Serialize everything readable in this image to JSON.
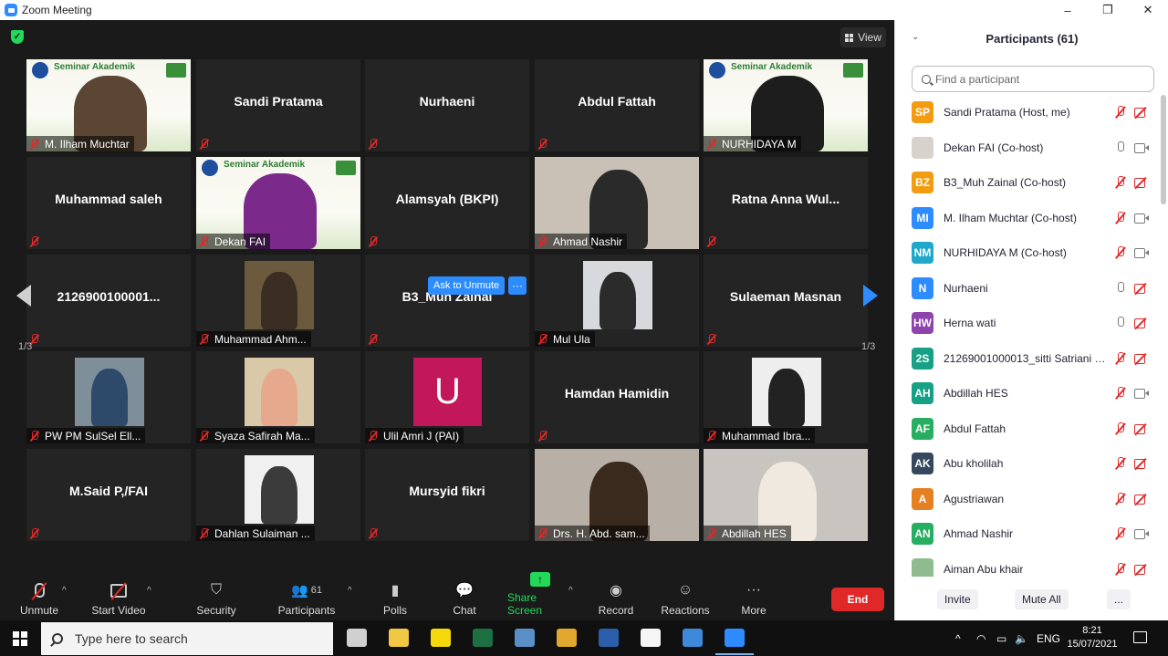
{
  "window": {
    "title": "Zoom Meeting",
    "controls": [
      "–",
      "❐",
      "✕"
    ]
  },
  "video": {
    "view_label": "View",
    "page_indicator": "1/3",
    "ask_unmute_label": "Ask to Unmute",
    "more_label": "···",
    "tiles": [
      {
        "name": "M. Ilham Muchtar",
        "display": "",
        "type": "seminar",
        "person_color": "#5a4632"
      },
      {
        "name": "",
        "display": "Sandi Pratama",
        "type": "name"
      },
      {
        "name": "",
        "display": "Nurhaeni",
        "type": "name"
      },
      {
        "name": "",
        "display": "Abdul Fattah",
        "type": "name"
      },
      {
        "name": "NURHIDAYA M",
        "display": "",
        "type": "seminar",
        "person_color": "#1d1d1d"
      },
      {
        "name": "",
        "display": "Muhammad saleh",
        "type": "name"
      },
      {
        "name": "Dekan FAI",
        "display": "",
        "type": "seminar",
        "person_color": "#7b2a8c"
      },
      {
        "name": "",
        "display": "Alamsyah (BKPI)",
        "type": "name"
      },
      {
        "name": "Ahmad Nashir",
        "display": "",
        "type": "photo",
        "bg": "#c9c0b6",
        "person_color": "#2a2a2a"
      },
      {
        "name": "",
        "display": "Ratna Anna Wul...",
        "type": "name"
      },
      {
        "name": "",
        "display": "2126900100001...",
        "type": "name"
      },
      {
        "name": "Muhammad Ahm...",
        "display": "",
        "type": "thumb",
        "bg": "#6b5a3e",
        "person_color": "#3a2e22"
      },
      {
        "name": "",
        "display": "B3_Muh Zainal",
        "type": "name"
      },
      {
        "name": "Mul Ula",
        "display": "",
        "type": "thumb",
        "bg": "#d7d9dc",
        "person_color": "#2b2b2b"
      },
      {
        "name": "",
        "display": "Sulaeman Masnan",
        "type": "name"
      },
      {
        "name": "PW PM SulSel Ell...",
        "display": "",
        "type": "thumb",
        "bg": "#7e8f9a",
        "person_color": "#2e4a6b"
      },
      {
        "name": "Syaza Safirah Ma...",
        "display": "",
        "type": "thumb",
        "bg": "#d9c9a8",
        "person_color": "#e7a98d"
      },
      {
        "name": "Ulil Amri J (PAI)",
        "display": "U",
        "type": "letter",
        "bg": "#c2185b"
      },
      {
        "name": "",
        "display": "Hamdan Hamidin",
        "type": "name"
      },
      {
        "name": "Muhammad Ibra...",
        "display": "",
        "type": "thumb",
        "bg": "#eeeeee",
        "person_color": "#222222"
      },
      {
        "name": "",
        "display": "M.Said P,/FAI",
        "type": "name"
      },
      {
        "name": "Dahlan Sulaiman ...",
        "display": "",
        "type": "thumb",
        "bg": "#f0f0f0",
        "person_color": "#3b3b3b"
      },
      {
        "name": "",
        "display": "Mursyid fikri",
        "type": "name"
      },
      {
        "name": "Drs. H. Abd. sam...",
        "display": "",
        "type": "photo",
        "bg": "#b8b0a6",
        "person_color": "#3a2a1e"
      },
      {
        "name": "Abdillah HES",
        "display": "",
        "type": "photo",
        "bg": "#c8c4bf",
        "person_color": "#efe9df"
      }
    ],
    "banner_title": "Seminar Akademik"
  },
  "toolbar": {
    "unmute": "Unmute",
    "start_video": "Start Video",
    "security": "Security",
    "participants": "Participants",
    "participants_count": "61",
    "polls": "Polls",
    "chat": "Chat",
    "share_screen": "Share Screen",
    "record": "Record",
    "reactions": "Reactions",
    "more": "More",
    "end": "End"
  },
  "participants_panel": {
    "title": "Participants (61)",
    "search_placeholder": "Find a participant",
    "invite": "Invite",
    "mute_all": "Mute All",
    "more": "...",
    "items": [
      {
        "initials": "SP",
        "color": "#f39c12",
        "name": "Sandi Pratama (Host, me)",
        "mic": "muted",
        "cam": "off"
      },
      {
        "initials": "",
        "color": "#d8d2cc",
        "name": "Dekan FAI (Co-host)",
        "mic": "on",
        "cam": "on"
      },
      {
        "initials": "BZ",
        "color": "#f39c12",
        "name": "B3_Muh Zainal (Co-host)",
        "mic": "muted",
        "cam": "off"
      },
      {
        "initials": "MI",
        "color": "#2d8cff",
        "name": "M. Ilham Muchtar (Co-host)",
        "mic": "muted",
        "cam": "on"
      },
      {
        "initials": "NM",
        "color": "#1fa8c9",
        "name": "NURHIDAYA M (Co-host)",
        "mic": "muted",
        "cam": "on"
      },
      {
        "initials": "N",
        "color": "#2d8cff",
        "name": "Nurhaeni",
        "mic": "on",
        "cam": "off"
      },
      {
        "initials": "HW",
        "color": "#8e44ad",
        "name": "Herna wati",
        "mic": "on",
        "cam": "off"
      },
      {
        "initials": "2S",
        "color": "#16a085",
        "name": "21269001000013_sitti Satriani Is...",
        "mic": "muted",
        "cam": "off"
      },
      {
        "initials": "AH",
        "color": "#16a085",
        "name": "Abdillah HES",
        "mic": "muted",
        "cam": "on"
      },
      {
        "initials": "AF",
        "color": "#27ae60",
        "name": "Abdul Fattah",
        "mic": "muted",
        "cam": "off"
      },
      {
        "initials": "AK",
        "color": "#34495e",
        "name": "Abu kholilah",
        "mic": "muted",
        "cam": "off"
      },
      {
        "initials": "A",
        "color": "#e67e22",
        "name": "Agustriawan",
        "mic": "muted",
        "cam": "off"
      },
      {
        "initials": "AN",
        "color": "#27ae60",
        "name": "Ahmad Nashir",
        "mic": "muted",
        "cam": "on"
      },
      {
        "initials": "",
        "color": "#8fbc8f",
        "name": "Aiman Abu khair",
        "mic": "muted",
        "cam": "off"
      }
    ]
  },
  "taskbar": {
    "search_placeholder": "Type here to search",
    "language": "ENG",
    "time": "8:21",
    "date": "15/07/2021",
    "apps": [
      {
        "name": "task-view",
        "color": "#d0d0d0"
      },
      {
        "name": "file-explorer",
        "color": "#f2c744"
      },
      {
        "name": "sticky-notes",
        "color": "#f5d90a"
      },
      {
        "name": "excel",
        "color": "#1d7044"
      },
      {
        "name": "network-app",
        "color": "#5a8fc7"
      },
      {
        "name": "chrome",
        "color": "#e0a82e"
      },
      {
        "name": "word",
        "color": "#2b5fab"
      },
      {
        "name": "document",
        "color": "#f5f5f5"
      },
      {
        "name": "photos",
        "color": "#3d8ad8"
      },
      {
        "name": "zoom",
        "color": "#2d8cff"
      }
    ]
  }
}
